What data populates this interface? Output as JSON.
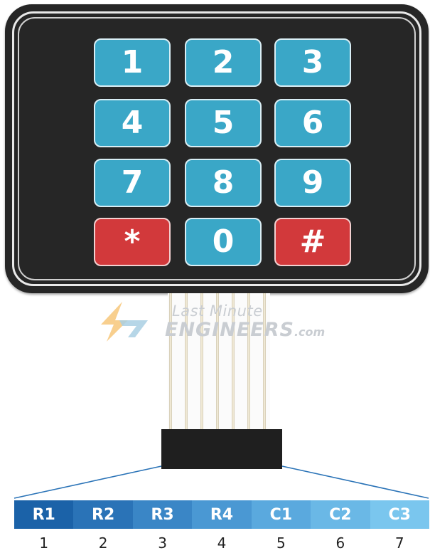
{
  "keypad": {
    "keys": [
      {
        "label": "1",
        "color": "#3aa7c7"
      },
      {
        "label": "2",
        "color": "#3aa7c7"
      },
      {
        "label": "3",
        "color": "#3aa7c7"
      },
      {
        "label": "4",
        "color": "#3aa7c7"
      },
      {
        "label": "5",
        "color": "#3aa7c7"
      },
      {
        "label": "6",
        "color": "#3aa7c7"
      },
      {
        "label": "7",
        "color": "#3aa7c7"
      },
      {
        "label": "8",
        "color": "#3aa7c7"
      },
      {
        "label": "9",
        "color": "#3aa7c7"
      },
      {
        "label": "*",
        "color": "#d2393b"
      },
      {
        "label": "0",
        "color": "#3aa7c7"
      },
      {
        "label": "#",
        "color": "#d2393b"
      }
    ]
  },
  "watermark": {
    "line1": "Last Minute",
    "line2": "ENGINEERS",
    "suffix": ".com"
  },
  "pins": [
    {
      "label": "R1",
      "number": "1",
      "color": "#1b62a8"
    },
    {
      "label": "R2",
      "number": "2",
      "color": "#2a73b7"
    },
    {
      "label": "R3",
      "number": "3",
      "color": "#3a86c6"
    },
    {
      "label": "R4",
      "number": "4",
      "color": "#4a98d3"
    },
    {
      "label": "C1",
      "number": "5",
      "color": "#5aa9de"
    },
    {
      "label": "C2",
      "number": "6",
      "color": "#6ab8e6"
    },
    {
      "label": "C3",
      "number": "7",
      "color": "#7ac6ee"
    }
  ]
}
